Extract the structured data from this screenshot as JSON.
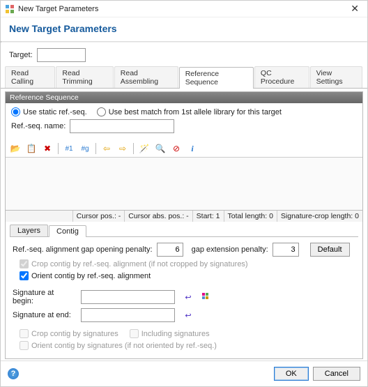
{
  "window": {
    "title": "New Target Parameters"
  },
  "header": {
    "title": "New Target Parameters"
  },
  "targetRow": {
    "label": "Target:",
    "value": ""
  },
  "tabs": {
    "items": [
      {
        "label": "Read Calling"
      },
      {
        "label": "Read Trimming"
      },
      {
        "label": "Read Assembling"
      },
      {
        "label": "Reference Sequence"
      },
      {
        "label": "QC Procedure"
      },
      {
        "label": "View Settings"
      }
    ],
    "activeIndex": 3
  },
  "refseq": {
    "groupTitle": "Reference Sequence",
    "radio_static": "Use static ref.-seq.",
    "radio_bestmatch": "Use best match from 1st allele library for this target",
    "name_label": "Ref.-seq. name:",
    "name_value": ""
  },
  "toolbar": {
    "i0": "open-icon",
    "i1": "paste-icon",
    "i2": "delete-icon",
    "i3": "hash1-icon",
    "i4": "hashg-icon",
    "i5": "left-icon",
    "i6": "right-icon",
    "i7": "wand-icon",
    "i8": "search-icon",
    "i9": "cancel-icon",
    "i10": "info-icon"
  },
  "status": {
    "cursor_label": "Cursor pos.:",
    "cursor_val": "-",
    "abs_label": "Cursor abs. pos.:",
    "abs_val": "-",
    "start_label": "Start:",
    "start_val": "1",
    "total_label": "Total length:",
    "total_val": "0",
    "sig_label": "Signature-crop length:",
    "sig_val": "0"
  },
  "subtabs": {
    "layers": "Layers",
    "contig": "Contig"
  },
  "contig": {
    "gap_open_label": "Ref.-seq. alignment gap opening penalty:",
    "gap_open_value": "6",
    "gap_ext_label": "gap extension penalty:",
    "gap_ext_value": "3",
    "default_btn": "Default",
    "crop_align": "Crop contig by ref.-seq. alignment (if not cropped by signatures)",
    "orient_align": "Orient contig by ref.-seq. alignment",
    "sig_begin_label": "Signature at begin:",
    "sig_begin_value": "",
    "sig_end_label": "Signature at end:",
    "sig_end_value": "",
    "crop_by_sig": "Crop contig by signatures",
    "incl_sig": "Including signatures",
    "orient_by_sig": "Orient contig by signatures (if not oriented by ref.-seq.)"
  },
  "footer": {
    "ok": "OK",
    "cancel": "Cancel"
  }
}
